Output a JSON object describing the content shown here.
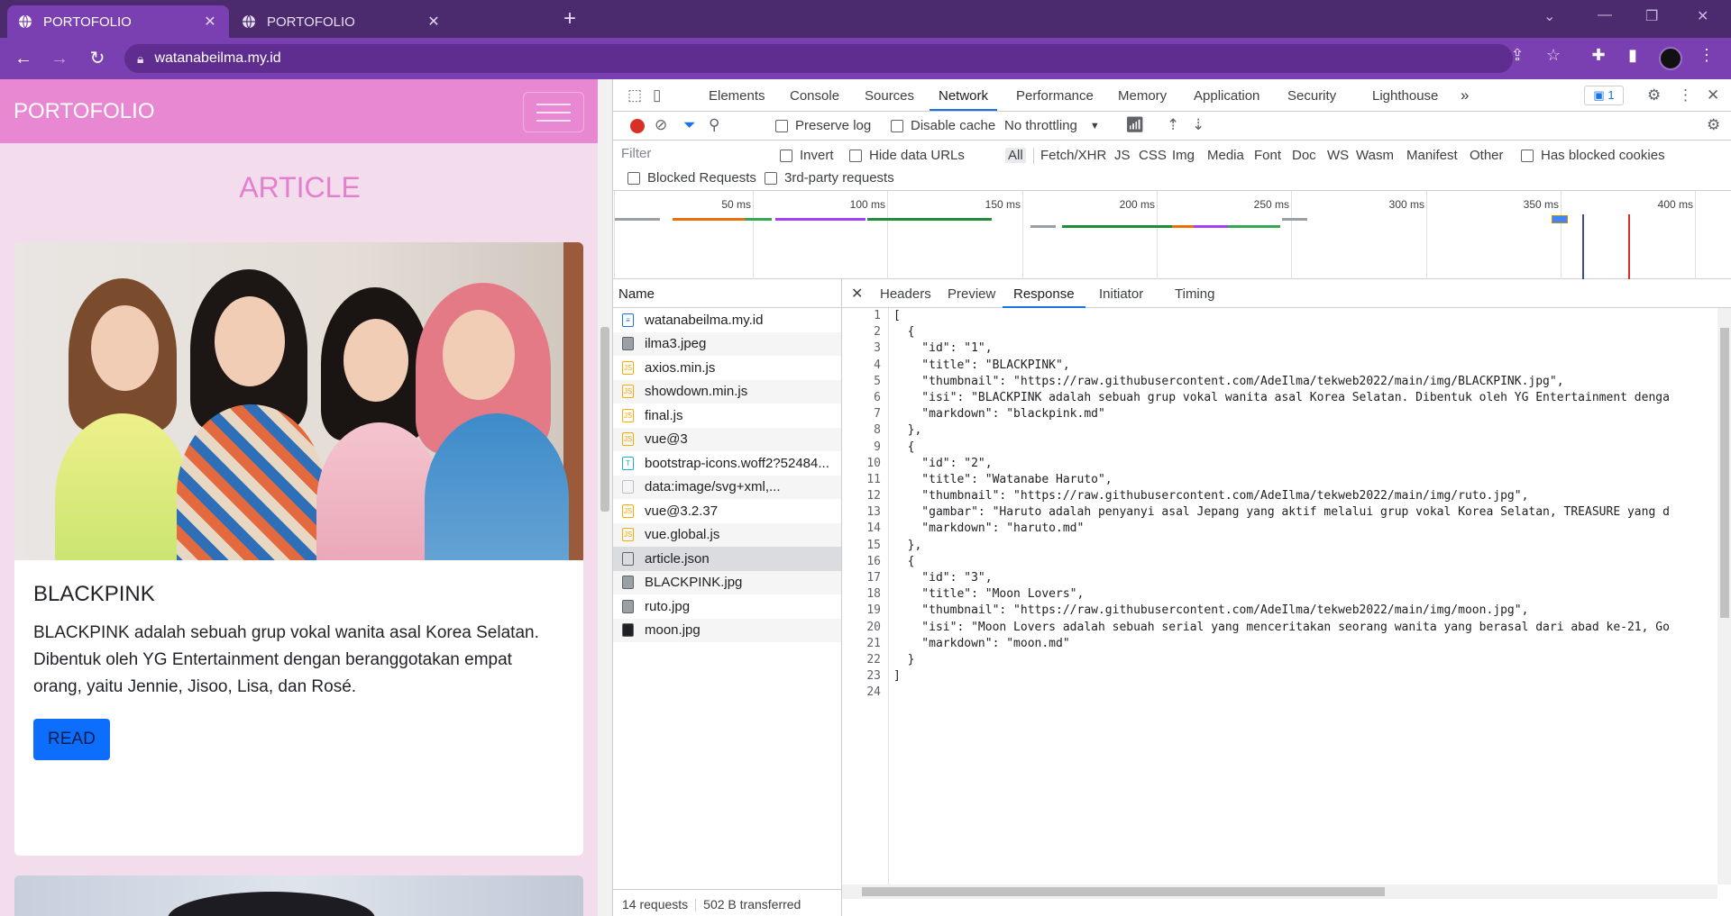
{
  "browser": {
    "tabs": [
      {
        "title": "PORTOFOLIO",
        "active": true
      },
      {
        "title": "PORTOFOLIO",
        "active": false
      }
    ],
    "url": "watanabeilma.my.id"
  },
  "page": {
    "brand": "PORTOFOLIO",
    "section_title": "ARTICLE",
    "card": {
      "title": "BLACKPINK",
      "text": "BLACKPINK adalah sebuah grup vokal wanita asal Korea Selatan. Dibentuk oleh YG Entertainment dengan beranggotakan empat orang, yaitu Jennie, Jisoo, Lisa, dan Rosé.",
      "button": "READ"
    }
  },
  "devtools": {
    "tabs": [
      "Elements",
      "Console",
      "Sources",
      "Network",
      "Performance",
      "Memory",
      "Application",
      "Security",
      "Lighthouse"
    ],
    "active_tab": "Network",
    "issues_count": "1",
    "toolbar": {
      "preserve_log": "Preserve log",
      "disable_cache": "Disable cache",
      "throttling": "No throttling"
    },
    "filter": {
      "placeholder": "Filter",
      "invert": "Invert",
      "hide_data_urls": "Hide data URLs",
      "types": [
        "All",
        "Fetch/XHR",
        "JS",
        "CSS",
        "Img",
        "Media",
        "Font",
        "Doc",
        "WS",
        "Wasm",
        "Manifest",
        "Other"
      ],
      "has_blocked_cookies": "Has blocked cookies",
      "blocked_requests": "Blocked Requests",
      "third_party": "3rd-party requests"
    },
    "timeline_ticks": [
      "50 ms",
      "100 ms",
      "150 ms",
      "200 ms",
      "250 ms",
      "300 ms",
      "350 ms",
      "400 ms"
    ],
    "name_header": "Name",
    "requests": [
      {
        "name": "watanabeilma.my.id",
        "icon": "doc"
      },
      {
        "name": "ilma3.jpeg",
        "icon": "img"
      },
      {
        "name": "axios.min.js",
        "icon": "js"
      },
      {
        "name": "showdown.min.js",
        "icon": "js"
      },
      {
        "name": "final.js",
        "icon": "js"
      },
      {
        "name": "vue@3",
        "icon": "js"
      },
      {
        "name": "bootstrap-icons.woff2?52484...",
        "icon": "font"
      },
      {
        "name": "data:image/svg+xml,...",
        "icon": "plain"
      },
      {
        "name": "vue@3.2.37",
        "icon": "js"
      },
      {
        "name": "vue.global.js",
        "icon": "js"
      },
      {
        "name": "article.json",
        "icon": "plain",
        "selected": true
      },
      {
        "name": "BLACKPINK.jpg",
        "icon": "img"
      },
      {
        "name": "ruto.jpg",
        "icon": "img"
      },
      {
        "name": "moon.jpg",
        "icon": "img"
      }
    ],
    "status": {
      "requests": "14 requests",
      "transferred": "502 B transferred"
    },
    "detail_tabs": [
      "Headers",
      "Preview",
      "Response",
      "Initiator",
      "Timing"
    ],
    "active_detail_tab": "Response",
    "response_lines": [
      "[",
      "  {",
      "    \"id\": \"1\",",
      "    \"title\": \"BLACKPINK\",",
      "    \"thumbnail\": \"https://raw.githubusercontent.com/AdeIlma/tekweb2022/main/img/BLACKPINK.jpg\",",
      "    \"isi\": \"BLACKPINK adalah sebuah grup vokal wanita asal Korea Selatan. Dibentuk oleh YG Entertainment denga",
      "    \"markdown\": \"blackpink.md\"",
      "  },",
      "  {",
      "    \"id\": \"2\",",
      "    \"title\": \"Watanabe Haruto\",",
      "    \"thumbnail\": \"https://raw.githubusercontent.com/AdeIlma/tekweb2022/main/img/ruto.jpg\",",
      "    \"gambar\": \"Haruto adalah penyanyi asal Jepang yang aktif melalui grup vokal Korea Selatan, TREASURE yang d",
      "    \"markdown\": \"haruto.md\"",
      "  },",
      "  {",
      "    \"id\": \"3\",",
      "    \"title\": \"Moon Lovers\",",
      "    \"thumbnail\": \"https://raw.githubusercontent.com/AdeIlma/tekweb2022/main/img/moon.jpg\",",
      "    \"isi\": \"Moon Lovers adalah sebuah serial yang menceritakan seorang wanita yang berasal dari abad ke-21, Go",
      "    \"markdown\": \"moon.md\"",
      "  }",
      "]",
      ""
    ]
  },
  "colors": {
    "browser_frame": "#4b2a6d",
    "browser_toolbar": "#7a3fb0",
    "navbar": "#e988d2",
    "page_bg": "#f3dcec",
    "accent_pink": "#e47fcf",
    "button_blue": "#0d6efd",
    "devtools_accent": "#1a73e8"
  }
}
